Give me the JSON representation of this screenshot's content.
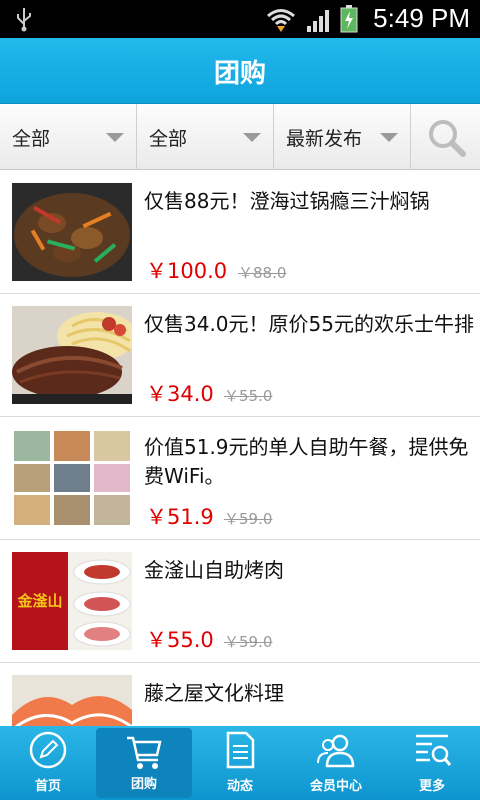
{
  "status_bar": {
    "time": "5:49 PM"
  },
  "header": {
    "title": "团购"
  },
  "filters": [
    {
      "label": "全部"
    },
    {
      "label": "全部"
    },
    {
      "label": "最新发布"
    }
  ],
  "deals": [
    {
      "name": "仅售88元！澄海过锅瘾三汁焖锅",
      "price": "￥100.0",
      "old_price": "￥88.0"
    },
    {
      "name": "仅售34.0元！原价55元的欢乐士牛排",
      "price": "￥34.0",
      "old_price": "￥55.0"
    },
    {
      "name": "价值51.9元的单人自助午餐，提供免费WiFi。",
      "price": "￥51.9",
      "old_price": "￥59.0"
    },
    {
      "name": "金滏山自助烤肉",
      "price": "￥55.0",
      "old_price": "￥59.0",
      "logo_text": "金滏山"
    },
    {
      "name": "藤之屋文化料理",
      "price": "",
      "old_price": ""
    }
  ],
  "tabs": [
    {
      "label": "首页",
      "icon": "pencil-icon"
    },
    {
      "label": "团购",
      "icon": "cart-icon"
    },
    {
      "label": "动态",
      "icon": "document-icon"
    },
    {
      "label": "会员中心",
      "icon": "members-icon"
    },
    {
      "label": "更多",
      "icon": "more-search-icon"
    }
  ],
  "colors": {
    "accent": "#0fa3dc",
    "price": "#e00000"
  }
}
